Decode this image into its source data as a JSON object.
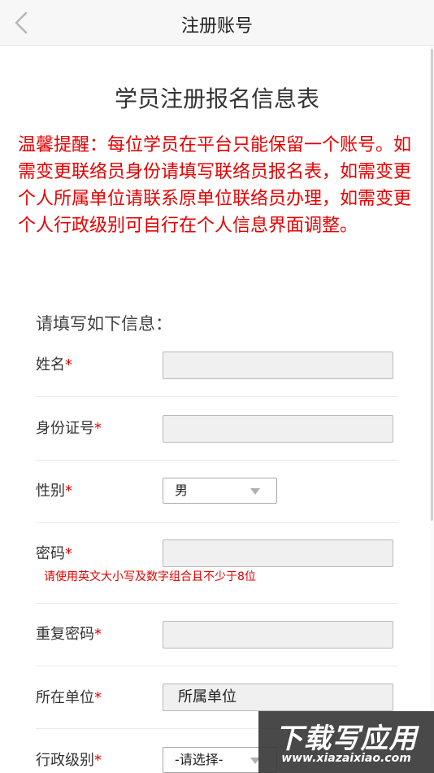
{
  "header": {
    "title": "注册账号",
    "back_icon": "chevron-left-icon"
  },
  "form": {
    "title": "学员注册报名信息表",
    "notice": "温馨提醒：每位学员在平台只能保留一个账号。如需变更联络员身份请填写联络员报名表，如需变更个人所属单位请联系原单位联络员办理，如需变更个人行政级别可自行在个人信息界面调整。",
    "fill_title": "请填写如下信息：",
    "required_mark": "*",
    "fields": {
      "name": {
        "label": "姓名",
        "value": ""
      },
      "id_number": {
        "label": "身份证号",
        "value": ""
      },
      "gender": {
        "label": "性别",
        "value": "男"
      },
      "password": {
        "label": "密码",
        "value": "",
        "hint": "请使用英文大小写及数字组合且不少于8位"
      },
      "repeat_password": {
        "label": "重复密码",
        "value": ""
      },
      "unit": {
        "label": "所在单位",
        "value": "所属单位"
      },
      "admin_level": {
        "label": "行政级别",
        "value": "-请选择-"
      }
    }
  },
  "watermark": {
    "top": "下载写应用",
    "bottom": "www.xiazaixiao.com"
  }
}
